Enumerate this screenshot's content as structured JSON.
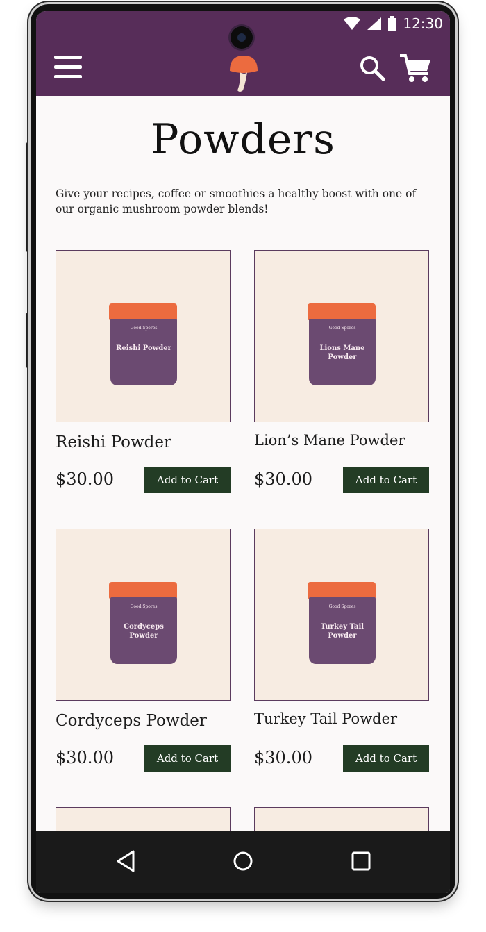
{
  "status_bar": {
    "time": "12:30"
  },
  "header": {
    "menu_icon": "hamburger-menu-icon",
    "logo_icon": "mushroom-logo-icon",
    "search_icon": "search-icon",
    "cart_icon": "shopping-cart-icon"
  },
  "page": {
    "title": "Powders",
    "intro": "Give your recipes, coffee or smoothies a healthy boost with one of our organic mushroom powder blends!"
  },
  "products": [
    {
      "name": "Reishi Powder",
      "price": "$30.00",
      "button": "Add to Cart",
      "jar_label": "Reishi Powder",
      "brand": "Good Spores"
    },
    {
      "name": "Lion’s Mane Powder",
      "price": "$30.00",
      "button": "Add to Cart",
      "jar_label": "Lions Mane Powder",
      "brand": "Good Spores"
    },
    {
      "name": "Cordyceps Powder",
      "price": "$30.00",
      "button": "Add to Cart",
      "jar_label": "Cordyceps Powder",
      "brand": "Good Spores"
    },
    {
      "name": "Turkey Tail Powder",
      "price": "$30.00",
      "button": "Add to Cart",
      "jar_label": "Turkey Tail Powder",
      "brand": "Good Spores"
    }
  ],
  "colors": {
    "header": "#572d59",
    "button": "#233c25",
    "lid": "#ec6b3f",
    "jar": "#6b4a71",
    "card_bg": "#f7ece2"
  },
  "nav": {
    "back_icon": "back-triangle-icon",
    "home_icon": "home-circle-icon",
    "recents_icon": "recents-square-icon"
  }
}
